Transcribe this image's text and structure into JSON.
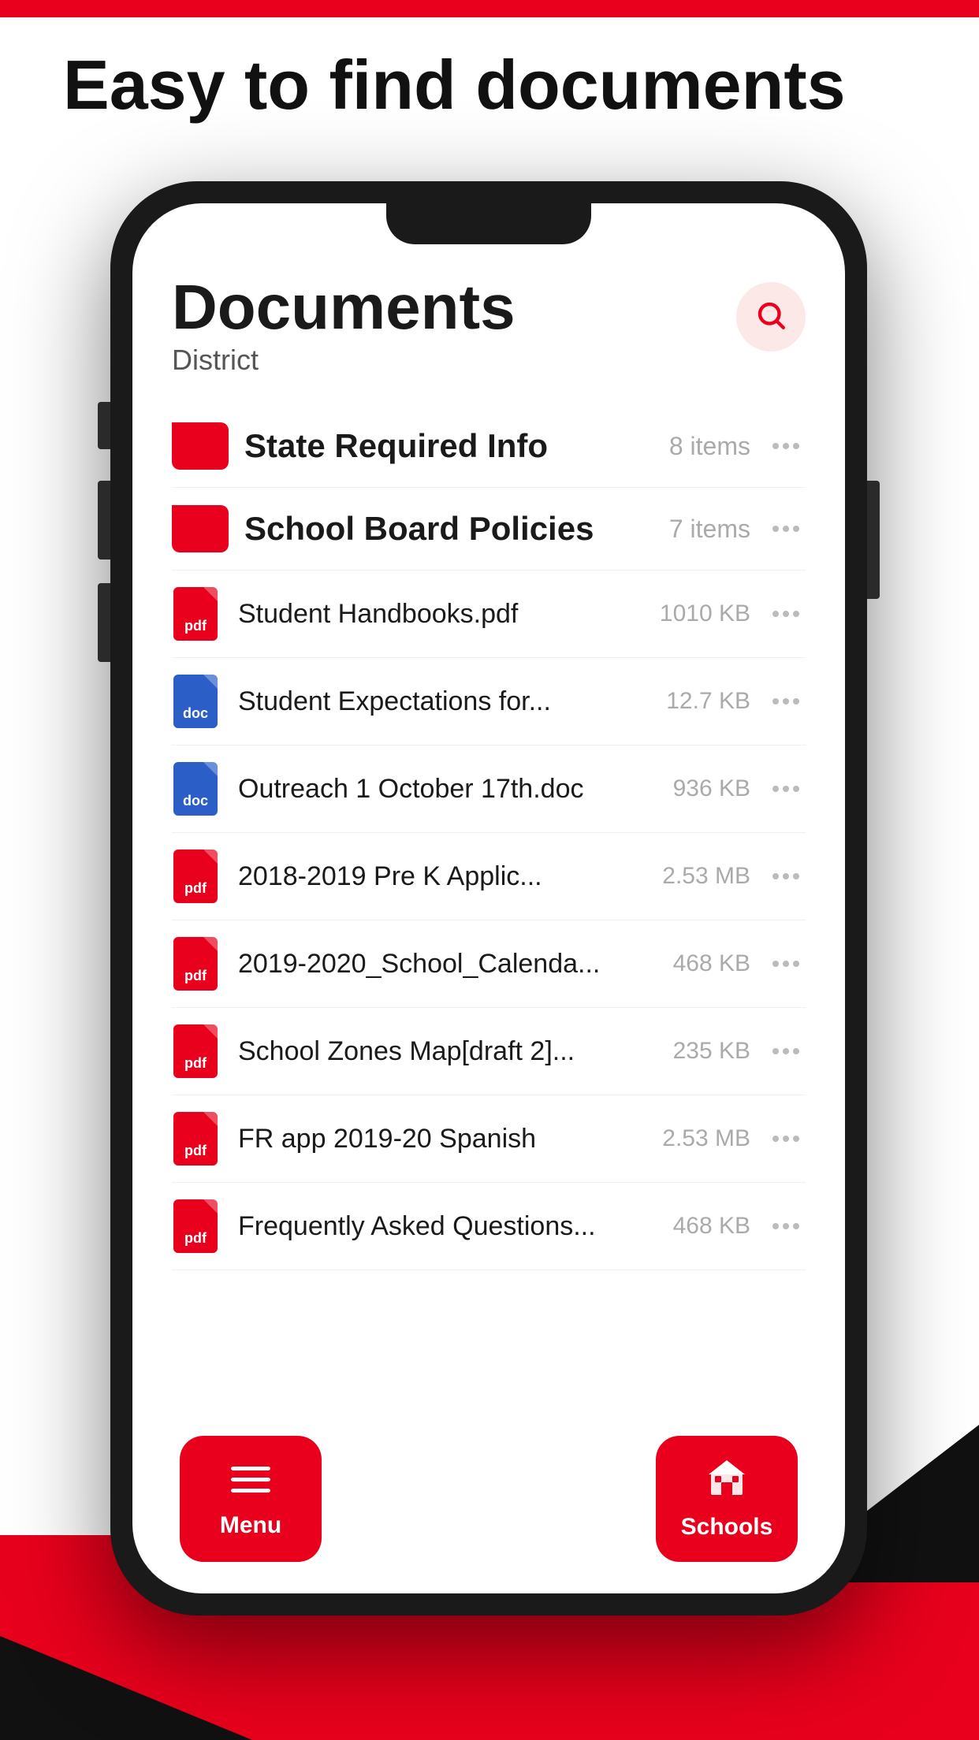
{
  "page": {
    "headline": "Easy to find documents",
    "background_top_color": "#e8001c",
    "background_bottom_color": "#e8001c"
  },
  "app": {
    "screen_title": "Documents",
    "screen_subtitle": "District",
    "search_icon": "search-icon"
  },
  "folders": [
    {
      "name": "State Required Info",
      "count": "8 items"
    },
    {
      "name": "School Board Policies",
      "count": "7 items"
    }
  ],
  "files": [
    {
      "name": "Student Handbooks.pdf",
      "type": "pdf",
      "size": "1010 KB"
    },
    {
      "name": "Student Expectations for...",
      "type": "doc",
      "size": "12.7 KB"
    },
    {
      "name": "Outreach 1 October 17th.doc",
      "type": "doc",
      "size": "936 KB"
    },
    {
      "name": "2018-2019 Pre K Applic...",
      "type": "pdf",
      "size": "2.53 MB"
    },
    {
      "name": "2019-2020_School_Calenda...",
      "type": "pdf",
      "size": "468 KB"
    },
    {
      "name": "School Zones Map[draft 2]...",
      "type": "pdf",
      "size": "235 KB"
    },
    {
      "name": "FR app 2019-20 Spanish",
      "type": "pdf",
      "size": "2.53 MB"
    },
    {
      "name": "Frequently Asked Questions...",
      "type": "pdf",
      "size": "468 KB"
    }
  ],
  "nav": {
    "menu_label": "Menu",
    "schools_label": "Schools",
    "menu_icon": "menu-icon",
    "schools_icon": "schools-icon"
  }
}
